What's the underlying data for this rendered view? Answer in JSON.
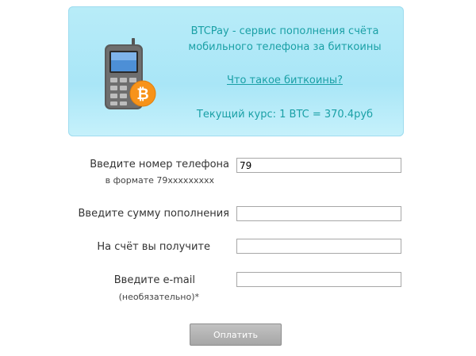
{
  "banner": {
    "title_line1": "BTCPay - сервис пополнения счёта",
    "title_line2": "мобильного телефона за биткоины",
    "link": "Что такое биткоины?",
    "rate": "Текущий курс: 1 BTC = 370.4руб",
    "icon": "mobile-phone-bitcoin-icon",
    "bitcoin_symbol": "₿"
  },
  "form": {
    "phone": {
      "label": "Введите номер телефона",
      "hint": "в формате 79xxxxxxxxx",
      "value": "79"
    },
    "amount": {
      "label": "Введите сумму пополнения",
      "value": ""
    },
    "receive": {
      "label": "На счёт вы получите",
      "value": ""
    },
    "email": {
      "label": "Введите e-mail",
      "hint": "(необязательно)*",
      "value": ""
    },
    "submit_label": "Оплатить"
  },
  "colors": {
    "banner_text": "#1aa0a6",
    "bitcoin_orange": "#f7931a"
  }
}
